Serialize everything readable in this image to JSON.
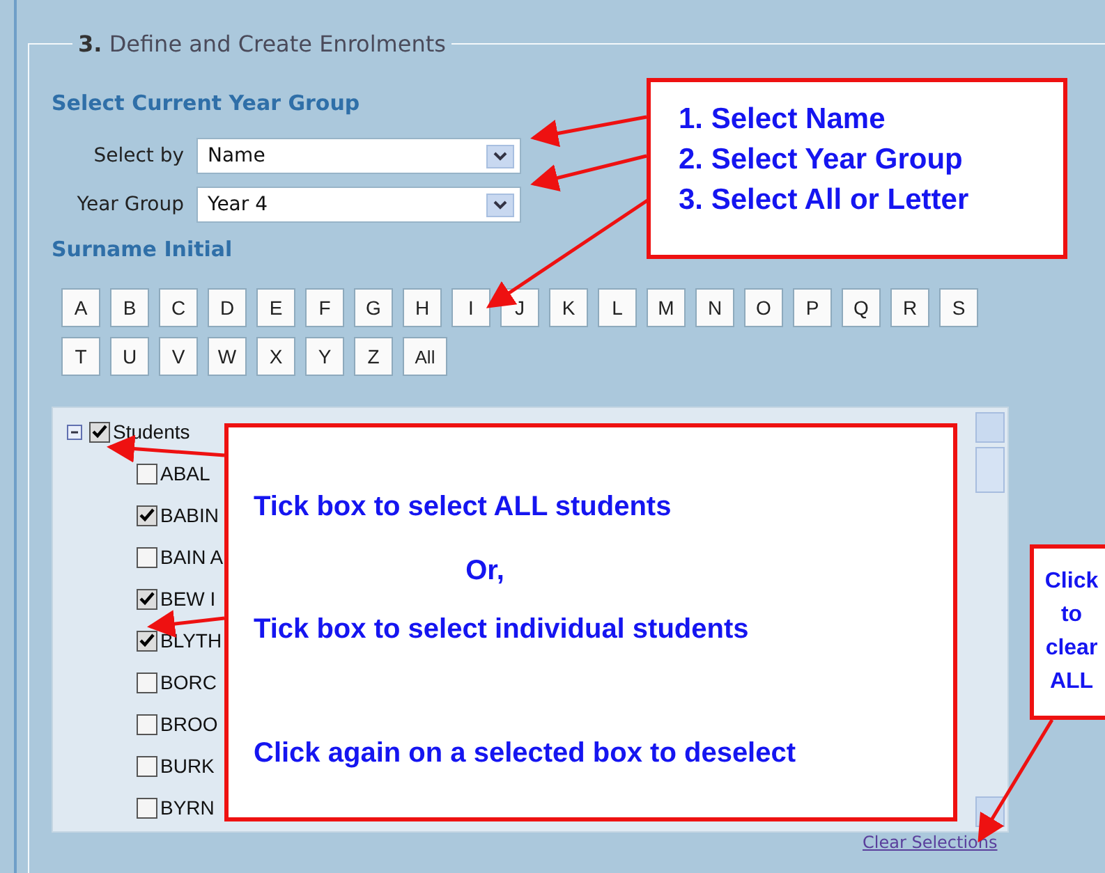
{
  "section": {
    "number": "3.",
    "title": "Define and Create Enrolments"
  },
  "year_heading": "Select Current Year Group",
  "fields": [
    {
      "label": "Select by",
      "value": "Name"
    },
    {
      "label": "Year Group",
      "value": "Year 4"
    }
  ],
  "initial_heading": "Surname Initial",
  "letters": [
    "A",
    "B",
    "C",
    "D",
    "E",
    "F",
    "G",
    "H",
    "I",
    "J",
    "K",
    "L",
    "M",
    "N",
    "O",
    "P",
    "Q",
    "R",
    "S",
    "T",
    "U",
    "V",
    "W",
    "X",
    "Y",
    "Z",
    "All"
  ],
  "tree": {
    "label": "Students",
    "checked": true,
    "expanded": true,
    "children": [
      {
        "name": "ABAL",
        "checked": false
      },
      {
        "name": "BABIN",
        "checked": true
      },
      {
        "name": "BAIN A",
        "checked": false
      },
      {
        "name": "BEW I",
        "checked": true
      },
      {
        "name": "BLYTH",
        "checked": true
      },
      {
        "name": "BORC",
        "checked": false
      },
      {
        "name": "BROO",
        "checked": false
      },
      {
        "name": "BURK",
        "checked": false
      },
      {
        "name": "BYRN",
        "checked": false
      }
    ]
  },
  "clear_link": "Clear Selections",
  "callouts": [
    {
      "kind": "steps",
      "lines": [
        {
          "text": "1.  Select Name"
        },
        {
          "text": "2.  Select Year Group"
        },
        {
          "text": "3.  Select All or Letter"
        }
      ]
    },
    {
      "kind": "notes",
      "lines": [
        {
          "text": "Tick box to select ALL students",
          "kind": "line"
        },
        {
          "text": "Or,",
          "kind": "aside"
        },
        {
          "text": "Tick box to select individual students",
          "kind": "line"
        },
        {
          "text": "Click again on a selected box to deselect",
          "kind": "line"
        }
      ]
    },
    {
      "kind": "side",
      "lines": [
        {
          "text": "Click"
        },
        {
          "text": "to"
        },
        {
          "text": "clear"
        },
        {
          "text": "ALL"
        }
      ]
    }
  ]
}
